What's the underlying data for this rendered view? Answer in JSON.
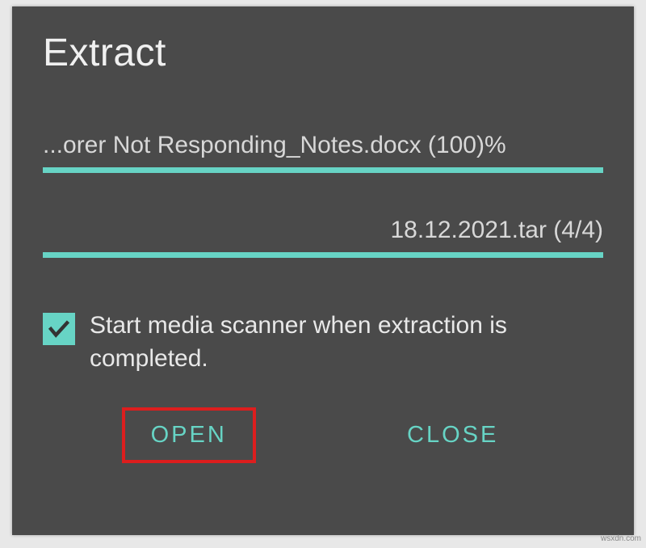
{
  "dialog": {
    "title": "Extract",
    "progress1": {
      "label": "...orer Not Responding_Notes.docx (100)%"
    },
    "progress2": {
      "label": "18.12.2021.tar (4/4)"
    },
    "checkbox": {
      "checked": true,
      "label": "Start media scanner when extraction is completed."
    },
    "buttons": {
      "open": "OPEN",
      "close": "CLOSE"
    }
  },
  "watermark": "wsxdn.com"
}
